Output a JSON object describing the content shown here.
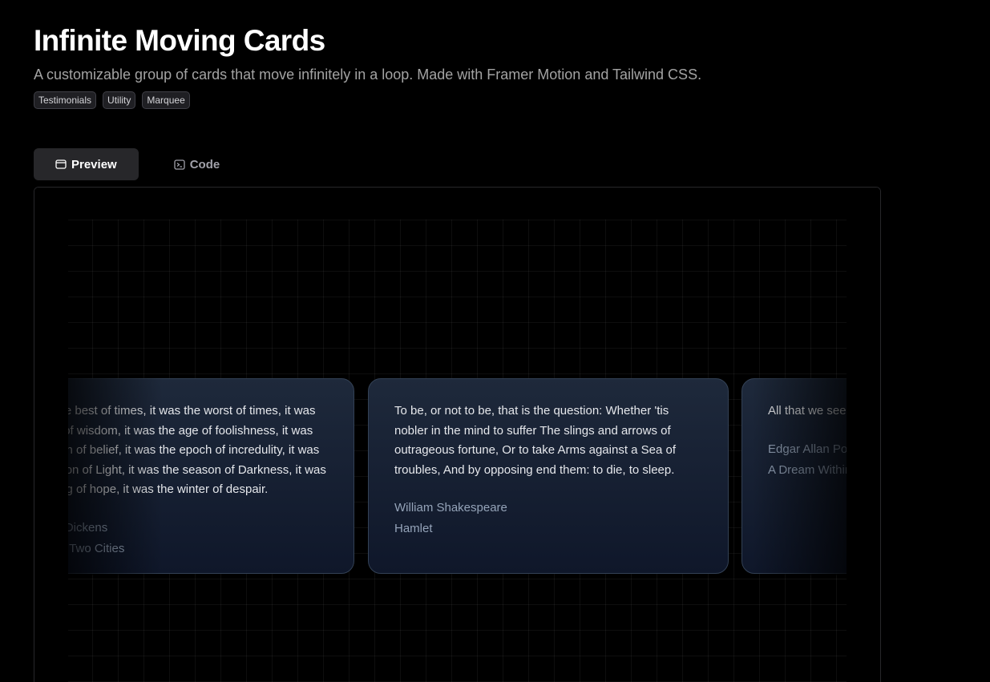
{
  "header": {
    "title": "Infinite Moving Cards",
    "subtitle": "A customizable group of cards that move infinitely in a loop. Made with Framer Motion and Tailwind CSS.",
    "tags": [
      "Testimonials",
      "Utility",
      "Marquee"
    ]
  },
  "tabs": [
    {
      "label": "Preview",
      "icon": "browser-window-icon",
      "active": true
    },
    {
      "label": "Code",
      "icon": "terminal-icon",
      "active": false
    }
  ],
  "cards": [
    {
      "quote": "It was the best of times, it was the worst of times, it was the age of wisdom, it was the age of foolishness, it was the epoch of belief, it was the epoch of incredulity, it was the season of Light, it was the season of Darkness, it was the spring of hope, it was the winter of despair.",
      "author": "Charles Dickens",
      "work": "A Tale of Two Cities"
    },
    {
      "quote": "To be, or not to be, that is the question: Whether 'tis nobler in the mind to suffer The slings and arrows of outrageous fortune, Or to take Arms against a Sea of troubles, And by opposing end them: to die, to sleep.",
      "author": "William Shakespeare",
      "work": "Hamlet"
    },
    {
      "quote": "All that we see or seem is but a dream within a dream.",
      "author": "Edgar Allan Poe",
      "work": "A Dream Within a Dream"
    }
  ]
}
